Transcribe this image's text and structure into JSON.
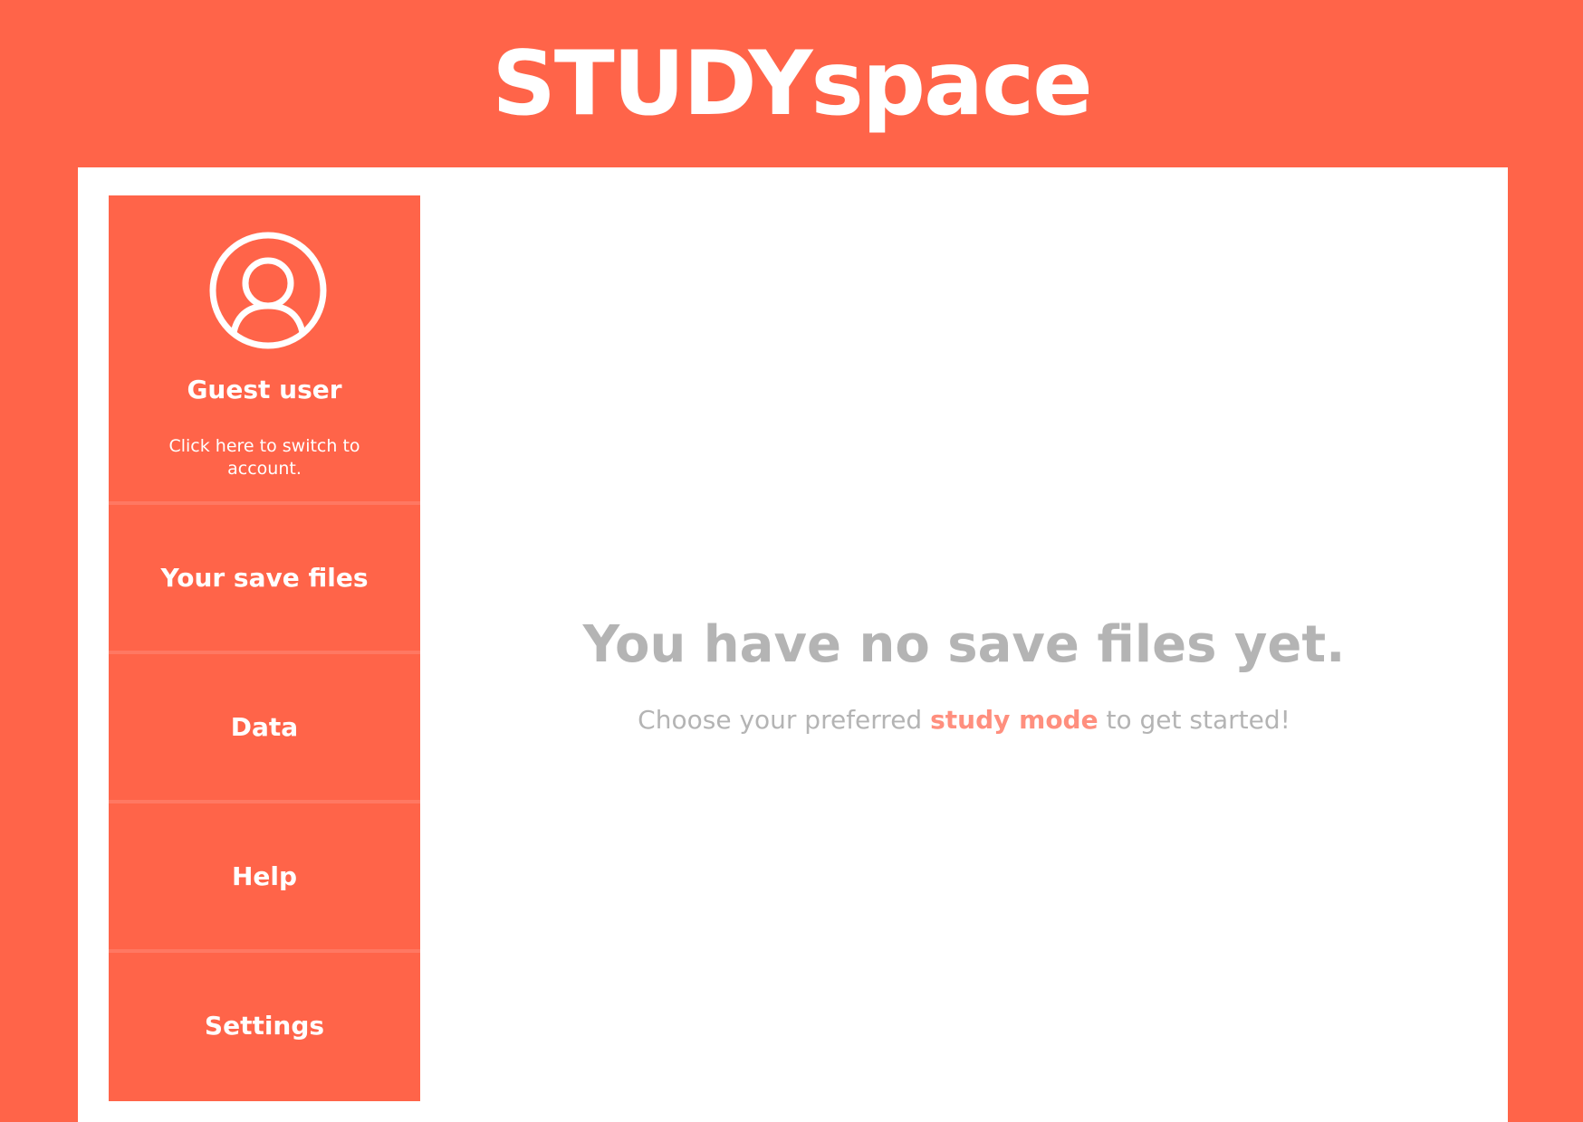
{
  "header": {
    "brand_part1": "STUDY",
    "brand_part2": "space"
  },
  "sidebar": {
    "profile": {
      "avatar_icon": "user-circle-icon",
      "name": "Guest user",
      "switch_text": "Click here to switch to account."
    },
    "items": [
      {
        "label": "Your save files"
      },
      {
        "label": "Data"
      },
      {
        "label": "Help"
      },
      {
        "label": "Settings"
      }
    ]
  },
  "main": {
    "empty_title": "You have no save files yet.",
    "subtitle_before": "Choose your preferred ",
    "subtitle_link": "study mode",
    "subtitle_after": " to get started!"
  },
  "colors": {
    "brand": "#FF6449",
    "panel": "#FFFFFF",
    "muted_text": "#B4B4B4",
    "link_accent": "#FF8F7E"
  }
}
